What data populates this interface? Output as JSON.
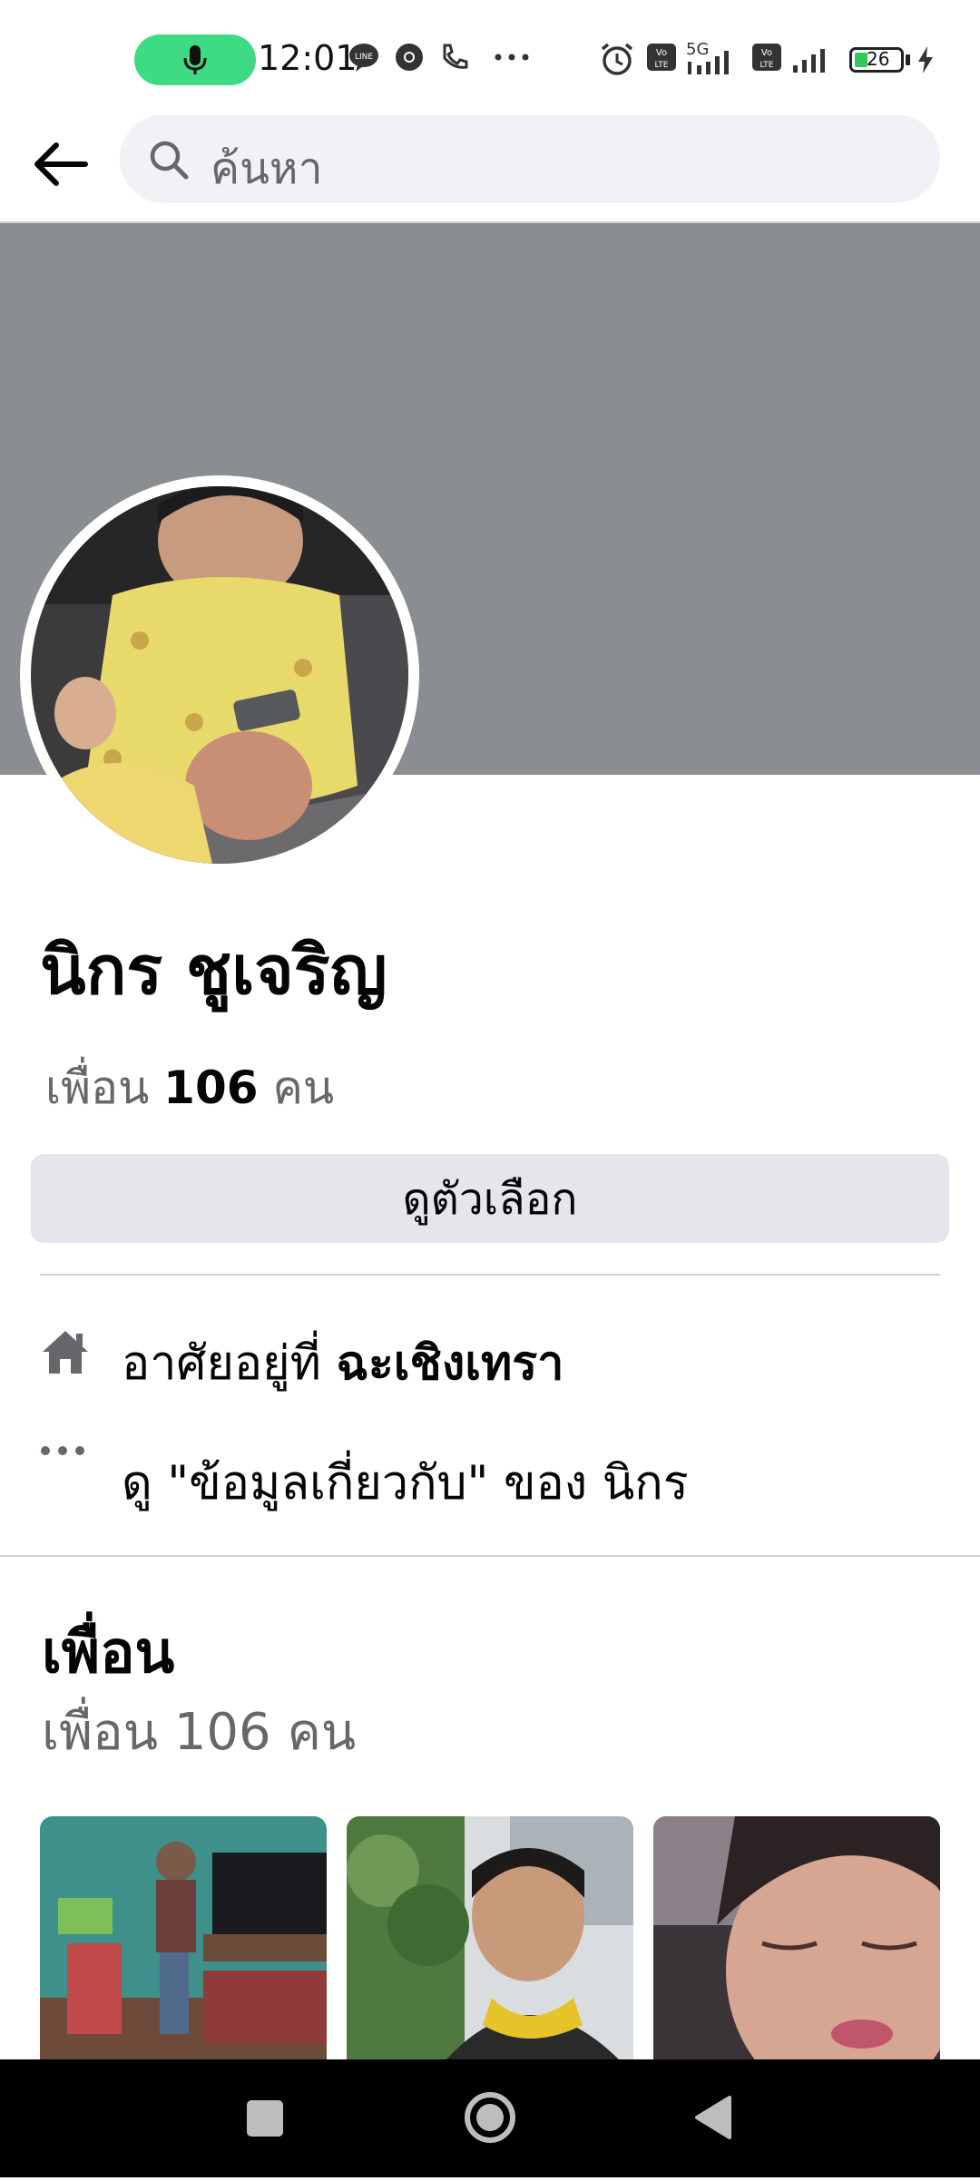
{
  "status_bar": {
    "time": "12:01",
    "battery": "26",
    "network": "5G"
  },
  "header": {
    "search_placeholder": "ค้นหา"
  },
  "profile": {
    "name": "นิกร ชูเจริญ",
    "friends_prefix": "เพื่อน",
    "friends_count": "106",
    "friends_suffix": "คน",
    "options_label": "ดูตัวเลือก",
    "lives_in_prefix": "อาศัยอยู่ที่",
    "lives_in_place": "ฉะเชิงเทรา",
    "about_link": "ดู \"ข้อมูลเกี่ยวกับ\" ของ นิกร"
  },
  "friends_section": {
    "title": "เพื่อน",
    "subtitle": "เพื่อน 106 คน"
  },
  "icons": [
    "mic-icon",
    "line-icon",
    "chrome-icon",
    "phone-icon",
    "alarm-icon",
    "volte-icon",
    "signal-icon",
    "battery-icon",
    "charging-icon",
    "back-arrow-icon",
    "search-icon",
    "home-icon",
    "more-icon",
    "recent-apps-icon",
    "home-circle-icon",
    "back-triangle-icon"
  ],
  "colors": {
    "cover": "#8a8d91",
    "button_bg": "#e4e6eb",
    "search_bg": "#f0f2f5",
    "secondary_text": "#65676b",
    "mic_pill": "#3ddc84"
  }
}
